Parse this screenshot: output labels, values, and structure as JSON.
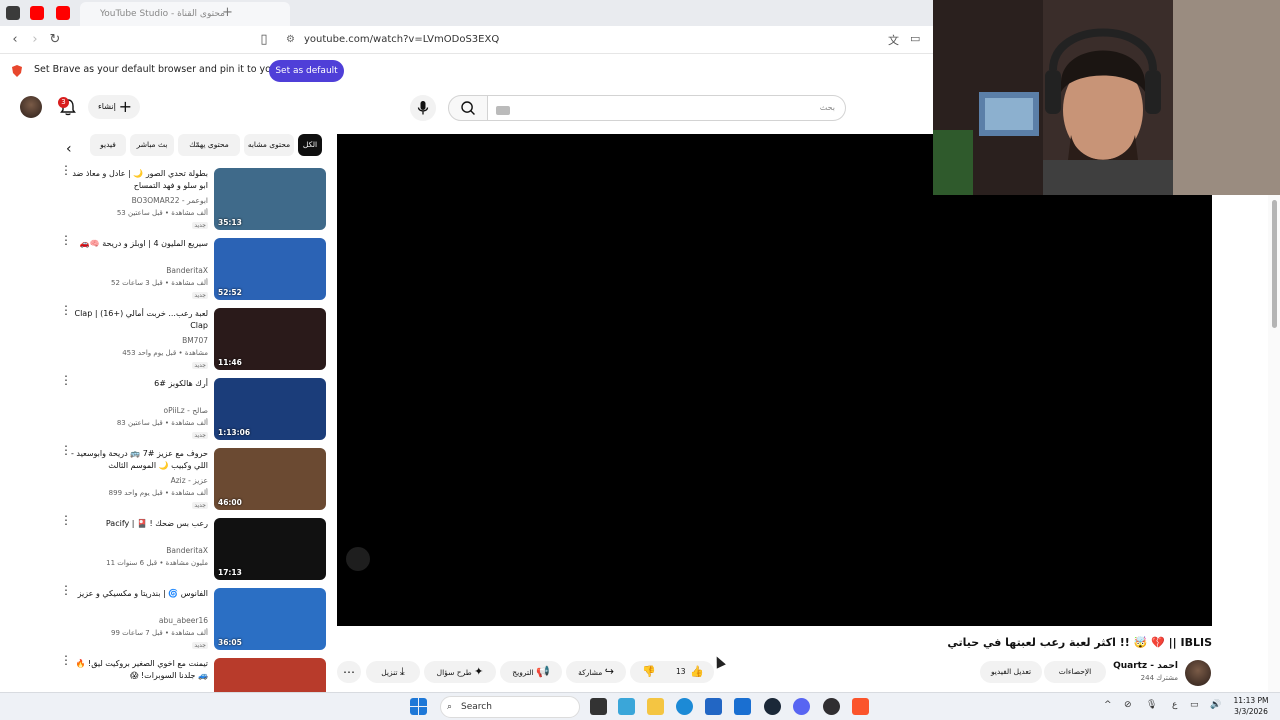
{
  "browser": {
    "tab_title": "YouTube Studio - محتوى القناة",
    "url": "youtube.com/watch?v=LVmODoS3EXQ"
  },
  "banner": {
    "text": "Set Brave as your default browser and pin it to your taskbar",
    "button": "Set as default"
  },
  "header": {
    "notification_count": "3",
    "create_label": "إنشاء",
    "search_placeholder": "بحث"
  },
  "chips": [
    "الكل",
    "محتوى مشابه",
    "محتوى يهمّك",
    "بث مباشر",
    "فيديو"
  ],
  "recommendations": [
    {
      "title": "بطولة تحدي الصور 🌙 | عادل و معاذ ضد ابو سلو و فهد التمساح",
      "channel": "BO3OMAR22 - ابوعمر",
      "meta": "53 ألف مشاهدة • قبل ساعتين",
      "new": "جديد",
      "duration": "35:13"
    },
    {
      "title": "سيريع المليون 4 | اوبلز و دريحة 🧠🚗",
      "channel": "BanderitaX",
      "meta": "52 ألف مشاهدة • قبل 3 ساعات",
      "new": "جديد",
      "duration": "52:52"
    },
    {
      "title": "لعبة رعب... خربت أمالي (+16) | Clap Clap",
      "channel": "BM707",
      "meta": "453 مشاهدة • قبل يوم واحد",
      "new": "جديد",
      "duration": "11:46"
    },
    {
      "title": "أرك هالكوبز #6",
      "channel": "oPiiLz - صالح",
      "meta": "83 ألف مشاهدة • قبل ساعتين",
      "new": "جديد",
      "duration": "1:13:06"
    },
    {
      "title": "حروف مع عزيز #7 🚌 دريحة وابوسعيد - اللي وكبيب 🌙 الموسم الثالث",
      "channel": "Aziz - عزيز",
      "meta": "899 ألف مشاهدة • قبل يوم واحد",
      "new": "جديد",
      "duration": "46:00"
    },
    {
      "title": "رعب بس ضحك ! 🎴 | Pacify",
      "channel": "BanderitaX",
      "meta": "11 مليون مشاهدة • قبل 6 سنوات",
      "new": "",
      "duration": "17:13"
    },
    {
      "title": "الفانوس 🌀 | بندريتا و مكسيكي و عزيز",
      "channel": "abu_abeer16",
      "meta": "99 ألف مشاهدة • قبل 7 ساعات",
      "new": "جديد",
      "duration": "36:05"
    },
    {
      "title": "تيمنت مع اخوي الصغير بروكيت ليق! 🔥🚙 جلدنا السوبرات! 😱",
      "channel": "",
      "meta": "",
      "new": "",
      "duration": ""
    }
  ],
  "video": {
    "title": "اكثر لعبة رعب لعبتها في حياتي !! 🤯 💔 || IBLIS",
    "channel_name": "Quartz - احمد",
    "channel_subs": "244 مشترك",
    "actions": {
      "analytics": "الإحصاءات",
      "edit": "تعديل الفيديو",
      "likes": "13",
      "share": "مشاركة",
      "promote": "الترويج",
      "ask": "طرح سؤال",
      "download": "تنزيل"
    }
  },
  "taskbar": {
    "search": "Search",
    "lang": "ع",
    "time": "11:13 PM",
    "date": "3/3/2026"
  },
  "colors": {
    "brave_accent": "#4f3fd8",
    "yt_red": "#ff0000"
  }
}
